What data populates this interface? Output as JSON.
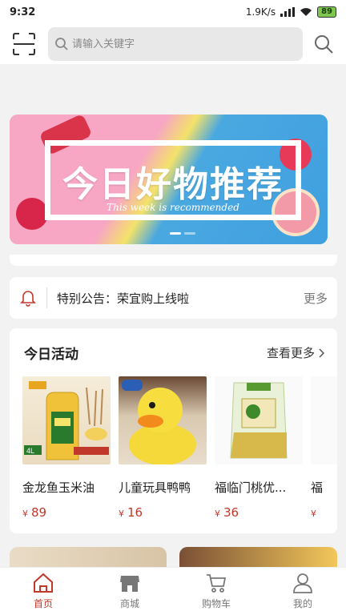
{
  "status_bar": {
    "time": "9:32",
    "network_speed": "1.9K/s",
    "battery": "89"
  },
  "search": {
    "placeholder": "请输入关键字"
  },
  "banner": {
    "title": "今日好物推荐",
    "subtitle": "This week is recommended"
  },
  "notice": {
    "text": "特别公告：荣宜购上线啦",
    "more_label": "更多"
  },
  "activity": {
    "title": "今日活动",
    "more_label": "查看更多",
    "products": [
      {
        "name": "金龙鱼玉米油",
        "currency": "¥",
        "price": "89"
      },
      {
        "name": "儿童玩具鸭鸭",
        "currency": "¥",
        "price": "16"
      },
      {
        "name": "福临门桃优...",
        "currency": "¥",
        "price": "36"
      },
      {
        "name": "福",
        "currency": "¥",
        "price": ""
      }
    ]
  },
  "tabbar": [
    {
      "label": "首页",
      "icon": "home-icon",
      "active": true
    },
    {
      "label": "商城",
      "icon": "shop-icon",
      "active": false
    },
    {
      "label": "购物车",
      "icon": "cart-icon",
      "active": false
    },
    {
      "label": "我的",
      "icon": "user-icon",
      "active": false
    }
  ],
  "colors": {
    "accent": "#c0392b",
    "background": "#f2f2f2"
  }
}
